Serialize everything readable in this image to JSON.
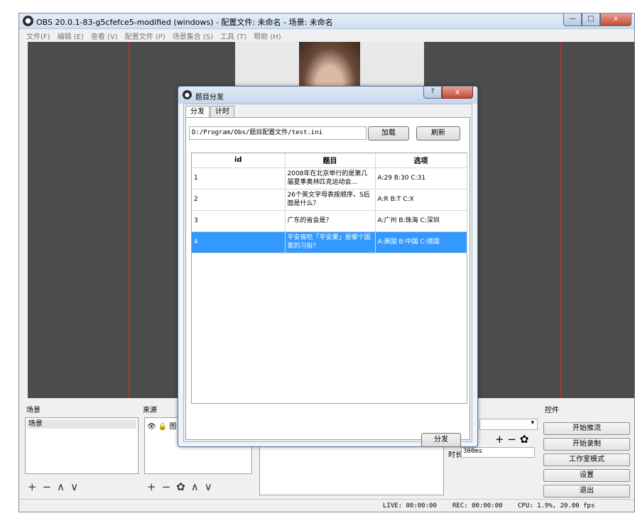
{
  "window": {
    "title": "OBS 20.0.1-83-g5cfefce5-modified (windows) - 配置文件: 未命名 - 场景: 未命名",
    "buttons": {
      "minimize": "—",
      "maximize": "□",
      "close": "x"
    }
  },
  "menu": [
    "文件(F)",
    "编辑 (E)",
    "查看 (V)",
    "配置文件 (P)",
    "场景集合 (S)",
    "工具 (T)",
    "帮助 (H)"
  ],
  "panels": {
    "scenes_header": "场景",
    "scene_item": "场景",
    "sources_header": "来源",
    "source_item": "图",
    "controls_header": "控件"
  },
  "toolbar": {
    "add": "+",
    "remove": "−",
    "up": "∧",
    "down": "∨",
    "settings": "✿"
  },
  "transition": {
    "duration_label": "时长",
    "duration_value": "300ms"
  },
  "controls": [
    "开始推流",
    "开始录制",
    "工作室模式",
    "设置",
    "退出"
  ],
  "status": {
    "live": "LIVE: 00:00:00",
    "rec": "REC: 00:00:00",
    "cpu": "CPU: 1.9%, 20.00 fps"
  },
  "dialog": {
    "title": "题目分发",
    "help": "?",
    "close": "x",
    "tabs": [
      "分发",
      "计时"
    ],
    "path": "D:/Program/Obs/题目配置文件/test.ini",
    "load_button": "加载",
    "refresh_button": "刷新",
    "columns": [
      "id",
      "题目",
      "选项"
    ],
    "rows": [
      {
        "id": "1",
        "question": "2008年在北京举行的是第几届夏季奥林匹克运动会…",
        "options": "A:29 B:30 C:31"
      },
      {
        "id": "2",
        "question": "26个英文字母表按顺序，S后面是什么？",
        "options": "A:R B:T C:X"
      },
      {
        "id": "3",
        "question": "广东的省会是？",
        "options": "A:广州 B:珠海 C:深圳"
      },
      {
        "id": "4",
        "question": "平安夜吃「平安果」是哪个国家的习俗？",
        "options": "A:美国 B:中国 C:德国"
      }
    ],
    "distribute_button": "分发"
  }
}
